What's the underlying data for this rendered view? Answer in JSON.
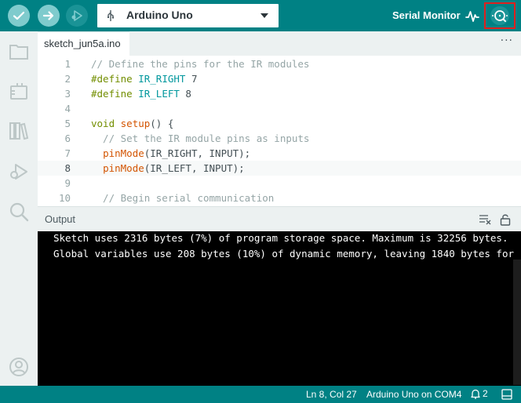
{
  "toolbar": {
    "board": "Arduino Uno",
    "serial_monitor_label": "Serial Monitor",
    "accent": "#008184",
    "highlight": "#e0201e",
    "icons": [
      "verify-check-icon",
      "upload-arrow-icon",
      "debug-icon",
      "usb-icon",
      "chevron-down-icon",
      "serial-plotter-icon",
      "serial-monitor-icon"
    ]
  },
  "sidebar": {
    "icons": [
      "sketchbook-icon",
      "boards-manager-icon",
      "library-manager-icon",
      "debug-icon",
      "search-icon",
      "account-icon"
    ]
  },
  "editor": {
    "tab": "sketch_jun5a.ino",
    "tab_more": "···",
    "lines": [
      {
        "n": "1",
        "text": "// Define the pins for the IR modules"
      },
      {
        "n": "2",
        "kw": "#define",
        "rest_const": "IR_RIGHT",
        "rest_num": " 7"
      },
      {
        "n": "3",
        "kw": "#define",
        "rest_const": "IR_LEFT",
        "rest_num": " 8"
      },
      {
        "n": "4"
      },
      {
        "n": "5",
        "kw": "void",
        "fn": "setup",
        "tail": "() {"
      },
      {
        "n": "6",
        "text": "  // Set the IR module pins as inputs"
      },
      {
        "n": "7",
        "fn": "pinMode",
        "tail": "(IR_RIGHT, INPUT);"
      },
      {
        "n": "8",
        "fn": "pinMode",
        "tail": "(IR_LEFT, INPUT);"
      },
      {
        "n": "9"
      },
      {
        "n": "10",
        "text": "  // Begin serial communication"
      }
    ],
    "active_line": "8"
  },
  "output": {
    "title": "Output",
    "lines": [
      "Sketch uses 2316 bytes (7%) of program storage space. Maximum is 32256 bytes.",
      "Global variables use 208 bytes (10%) of dynamic memory, leaving 1840 bytes for"
    ]
  },
  "status": {
    "position": "Ln 8, Col 27",
    "board_port": "Arduino Uno on COM4",
    "notifications": "2"
  }
}
